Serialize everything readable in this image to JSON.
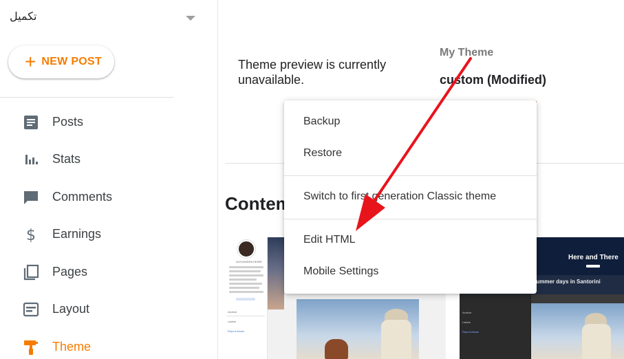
{
  "sidebar": {
    "blog_name": "تكميل",
    "new_post_label": "NEW POST",
    "items": [
      {
        "label": "Posts",
        "icon": "posts-icon"
      },
      {
        "label": "Stats",
        "icon": "stats-icon"
      },
      {
        "label": "Comments",
        "icon": "comments-icon"
      },
      {
        "label": "Earnings",
        "icon": "earnings-icon"
      },
      {
        "label": "Pages",
        "icon": "pages-icon"
      },
      {
        "label": "Layout",
        "icon": "layout-icon"
      },
      {
        "label": "Theme",
        "icon": "theme-icon",
        "active": true
      }
    ]
  },
  "main": {
    "preview_text": "Theme preview is currently unavailable.",
    "my_theme_label": "My Theme",
    "theme_name": "custom (Modified)",
    "section_title": "Contemporary",
    "cards": {
      "left": {
        "author": "ALEXANDRA HENRI",
        "archive_label": "Archive",
        "labels_label": "Labels",
        "report_label": "Report Abuse"
      },
      "right": {
        "hero_title": "Here and There",
        "subtitle": "Summer days in Santorini",
        "archive_label": "Archive",
        "labels_label": "Labels",
        "report_label": "Report Abuse"
      }
    }
  },
  "menu": {
    "items": [
      "Backup",
      "Restore",
      "Switch to first generation Classic theme",
      "Edit HTML",
      "Mobile Settings"
    ]
  },
  "colors": {
    "accent": "#f57c00",
    "annotation_arrow": "#e8141c"
  }
}
